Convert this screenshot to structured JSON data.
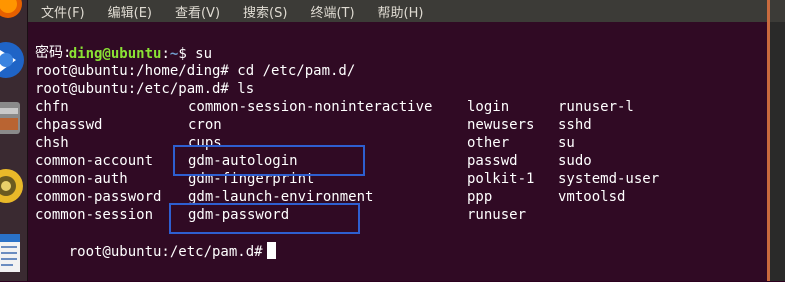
{
  "menubar": {
    "items": [
      "文件(F)",
      "编辑(E)",
      "查看(V)",
      "搜索(S)",
      "终端(T)",
      "帮助(H)"
    ]
  },
  "terminal": {
    "prompt_user": "ding@ubuntu",
    "prompt_sep1": ":",
    "prompt_path": "~",
    "prompt_cmd": "$ su",
    "password_prompt": "密码:",
    "line3": "root@ubuntu:/home/ding# cd /etc/pam.d/",
    "line4": "root@ubuntu:/etc/pam.d# ls",
    "ls_columns": [
      [
        "chfn",
        "chpasswd",
        "chsh",
        "common-account",
        "common-auth",
        "common-password",
        "common-session"
      ],
      [
        "common-session-noninteractive",
        "cron",
        "cups",
        "gdm-autologin",
        "gdm-fingerprint",
        "gdm-launch-environment",
        "gdm-password"
      ],
      [
        "login",
        "newusers",
        "other",
        "passwd",
        "polkit-1",
        "ppp",
        "runuser"
      ],
      [
        "runuser-l",
        "sshd",
        "su",
        "sudo",
        "systemd-user",
        "vmtoolsd"
      ]
    ],
    "last_prompt": "root@ubuntu:/etc/pam.d#"
  },
  "colors": {
    "terminal_bg": "#300a24",
    "user_green": "#8ae234",
    "path_blue": "#729fcf",
    "highlight_box": "#2e5fd0"
  },
  "launcher_icons": [
    "firefox-icon",
    "thunderbird-icon",
    "files-icon",
    "rhythmbox-icon",
    "writer-icon"
  ]
}
